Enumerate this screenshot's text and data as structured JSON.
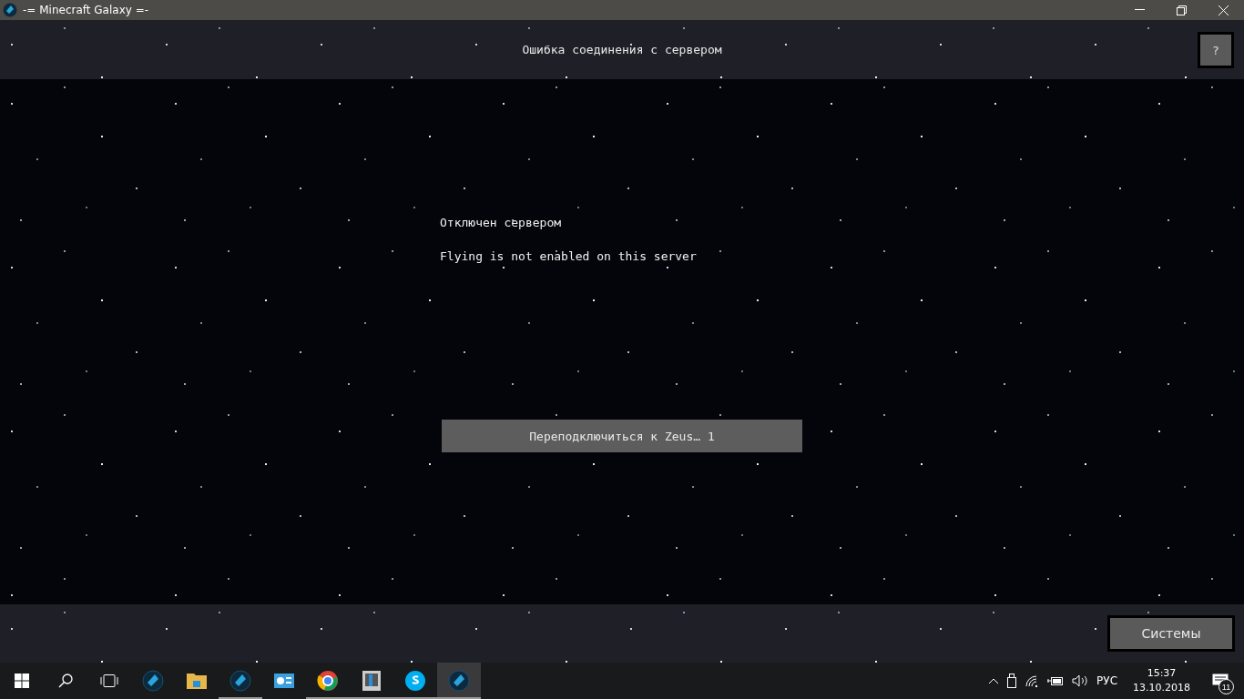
{
  "window": {
    "title": "-= Minecraft Galaxy =-"
  },
  "header": {
    "title": "Ошибка соединения с сервером",
    "help_button": "?"
  },
  "message": {
    "lines": [
      "Отключен сервером",
      "Flying is not enabled on this server"
    ]
  },
  "reconnect_button": "Переподключиться к Zeus… 1",
  "footer": {
    "button": "Системы"
  },
  "taskbar": {
    "apps": [
      {
        "kind": "sphere",
        "running": false,
        "selected": false
      },
      {
        "kind": "folder",
        "running": false,
        "selected": false
      },
      {
        "kind": "sphere",
        "running": true,
        "selected": false
      },
      {
        "kind": "panel",
        "running": false,
        "selected": false
      },
      {
        "kind": "ring",
        "running": true,
        "selected": false
      },
      {
        "kind": "device",
        "running": true,
        "selected": false
      },
      {
        "kind": "bubble",
        "running": true,
        "selected": false
      },
      {
        "kind": "sphere",
        "running": true,
        "selected": true
      }
    ],
    "language": "РУС",
    "time": "15:37",
    "date": "13.10.2018",
    "notifications": "11"
  }
}
